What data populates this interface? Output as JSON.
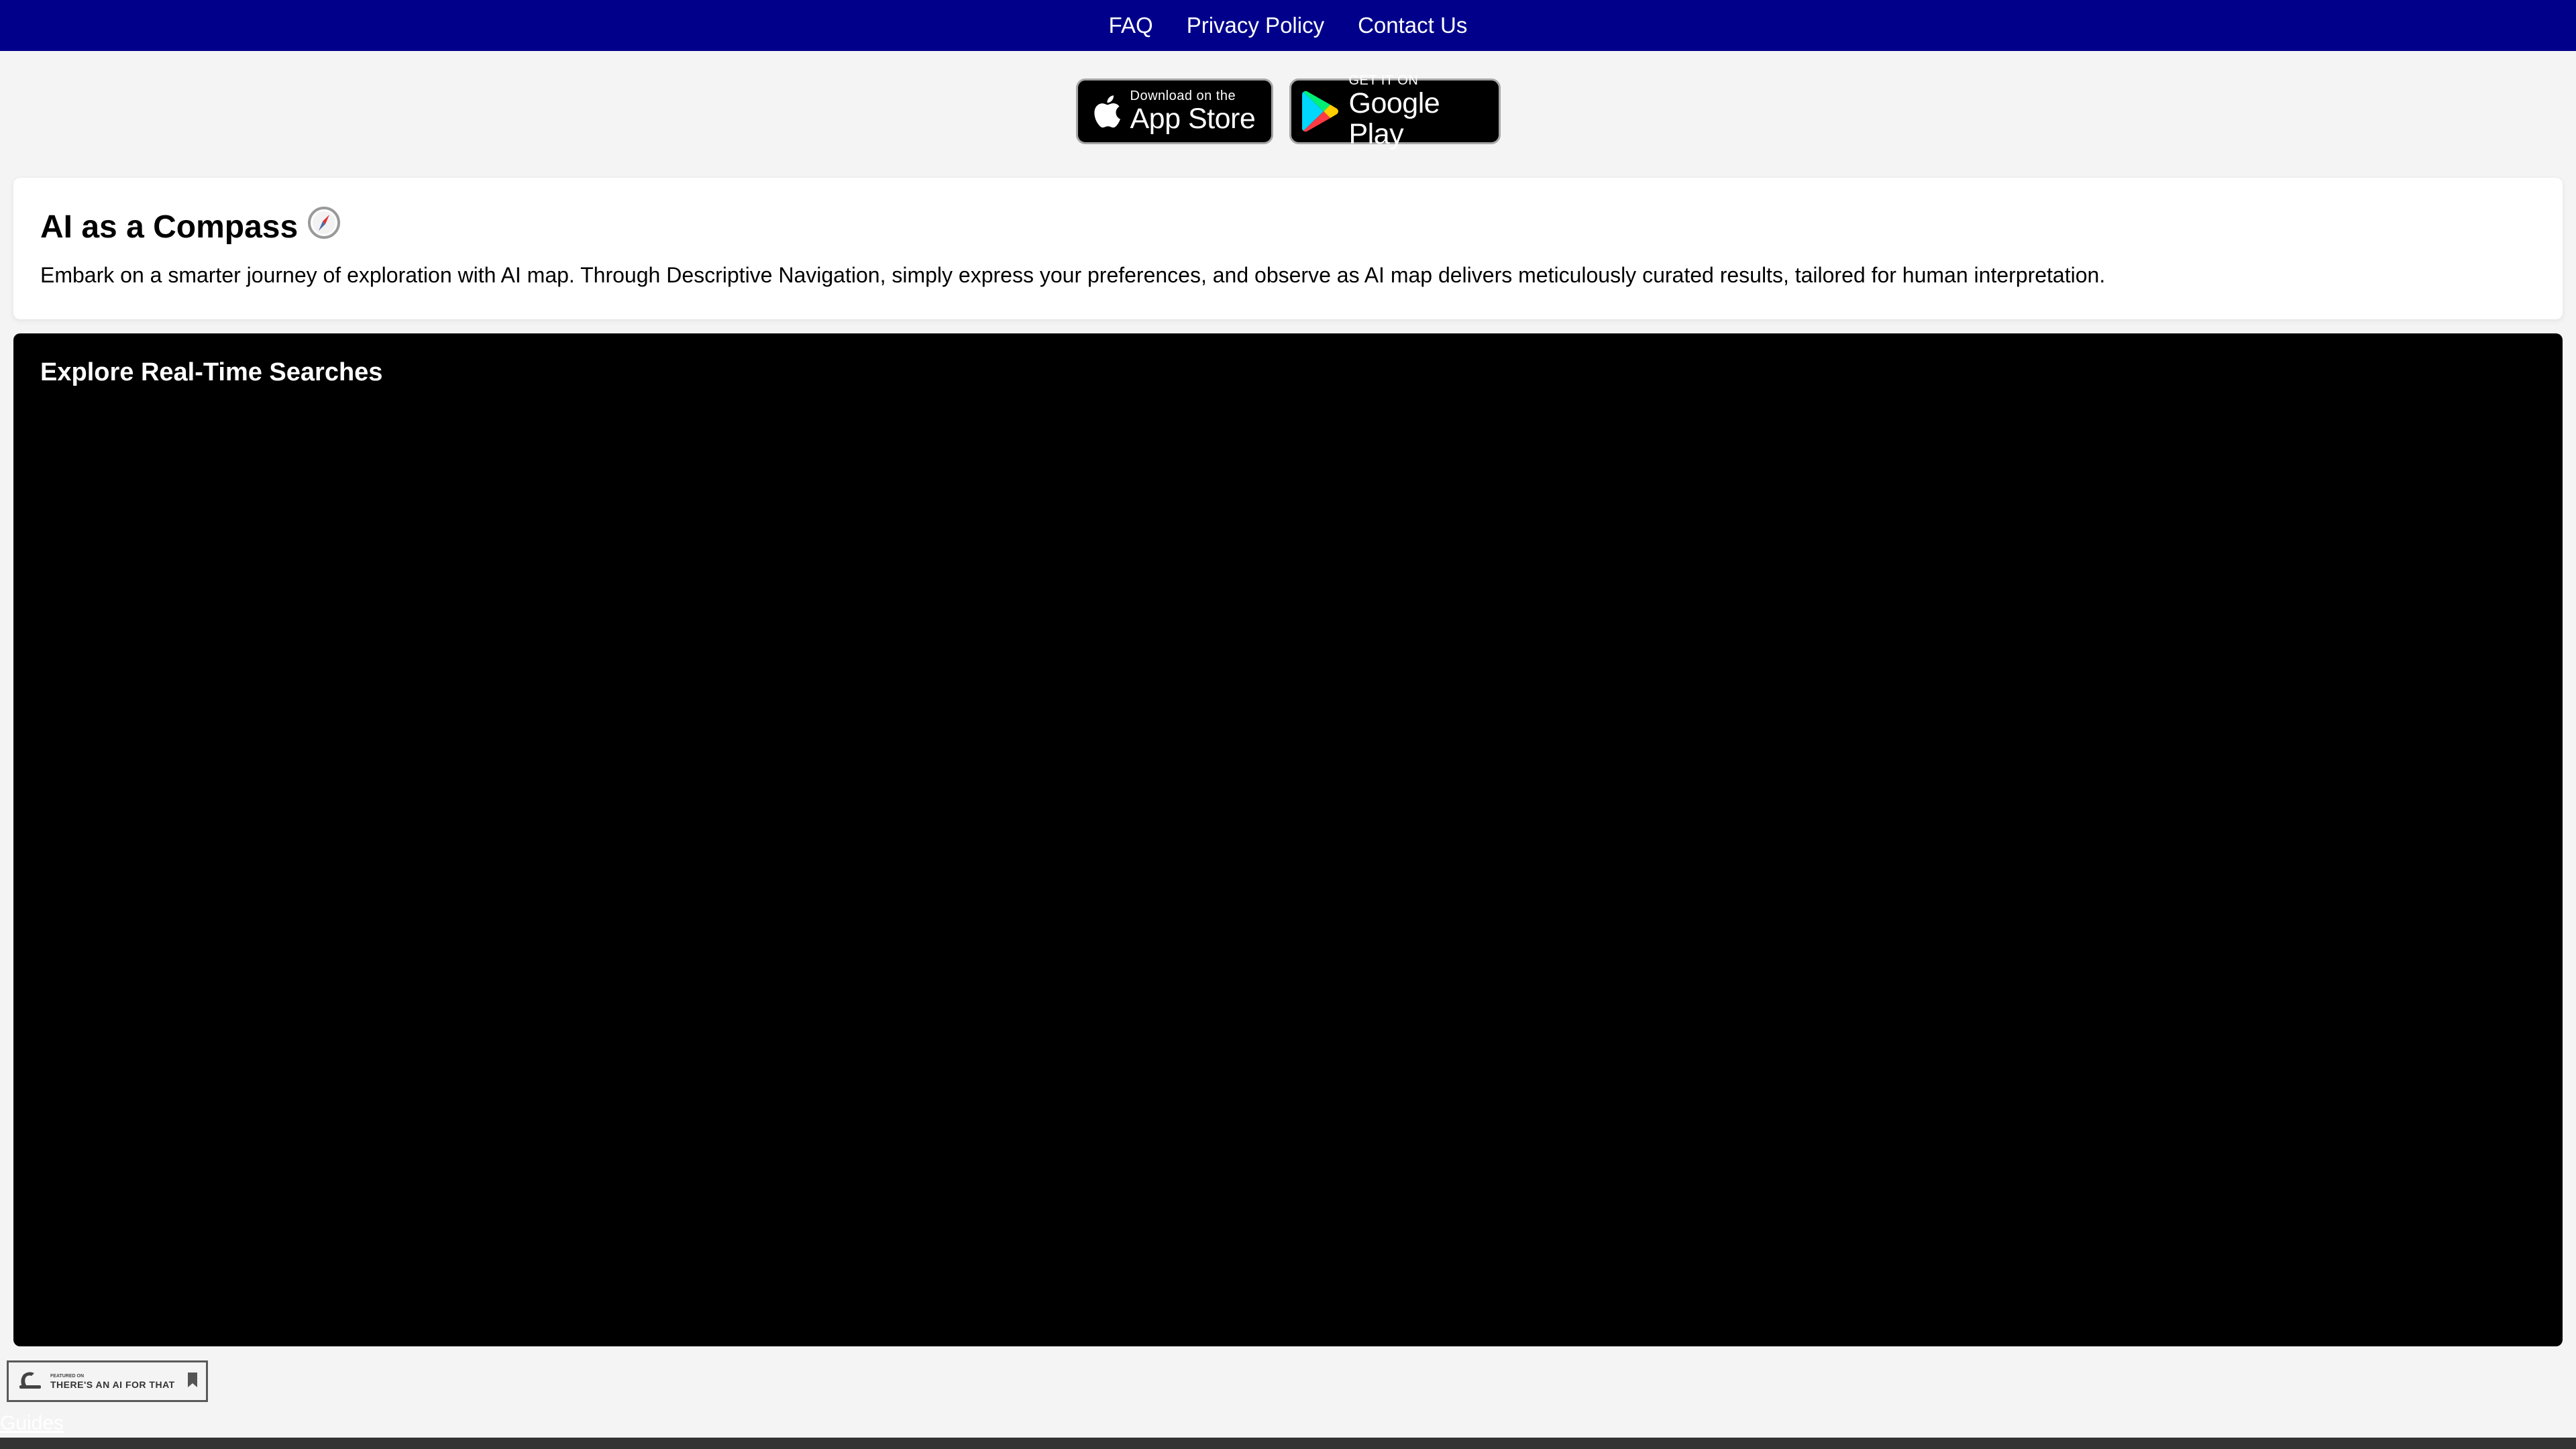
{
  "nav": {
    "links": [
      "FAQ",
      "Privacy Policy",
      "Contact Us"
    ]
  },
  "badges": {
    "app_store": {
      "small": "Download on the",
      "big": "App Store",
      "icon": "apple-icon"
    },
    "google_play": {
      "small": "GET IT ON",
      "big": "Google Play",
      "icon": "google-play-icon"
    }
  },
  "info": {
    "title": "AI as a Compass",
    "title_icon": "compass-icon",
    "description": "Embark on a smarter journey of exploration with AI map. Through Descriptive Navigation, simply express your preferences, and observe as AI map delivers meticulously curated results, tailored for human interpretation."
  },
  "explore": {
    "title": "Explore Real-Time Searches"
  },
  "featured": {
    "small": "FEATURED ON",
    "big": "THERE'S AN AI FOR THAT"
  },
  "footer": {
    "link": "Guides"
  },
  "colors": {
    "nav_bg": "#00008b",
    "page_bg": "#f4f4f4",
    "explore_bg": "#000000",
    "bottom_bar": "#333333"
  }
}
